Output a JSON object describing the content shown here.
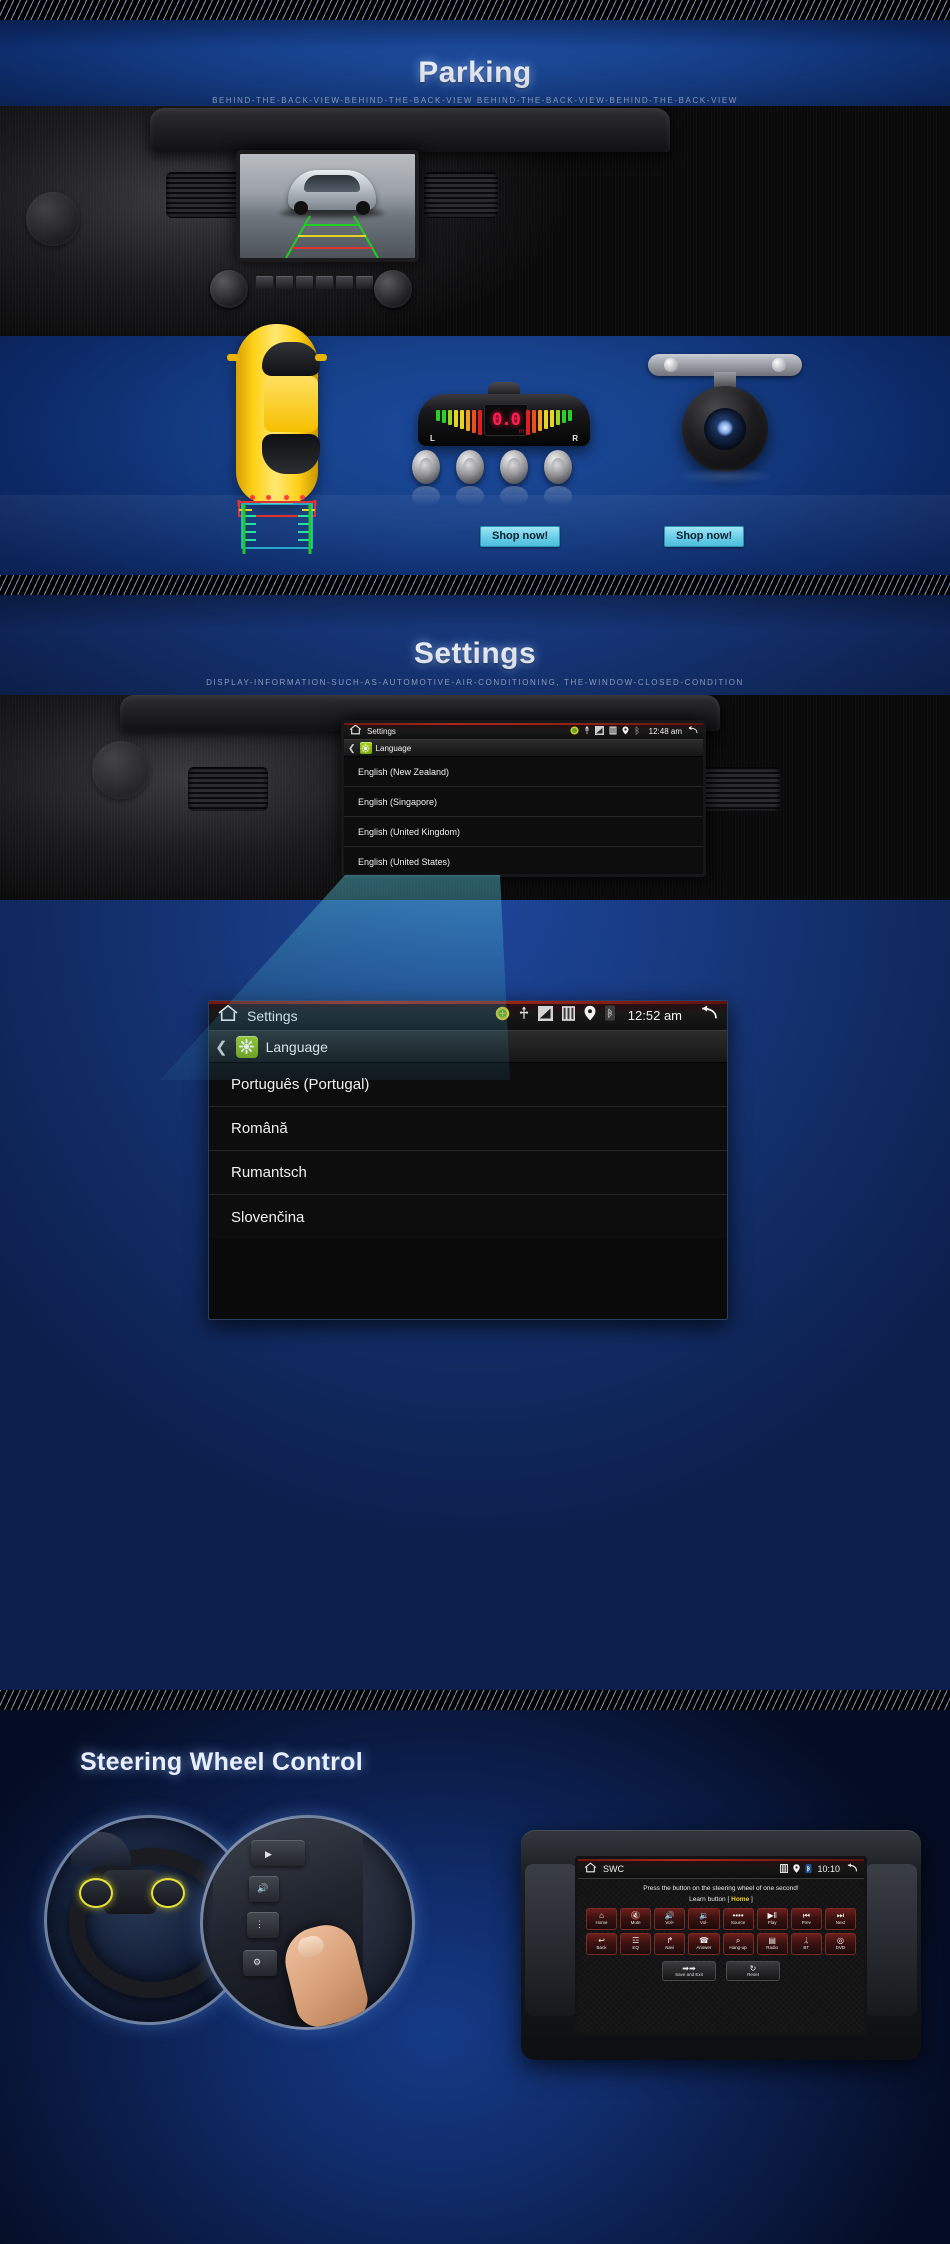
{
  "sections": {
    "parking": {
      "title": "Parking",
      "subtitle": "BEHIND-THE-BACK-VIEW-BEHIND-THE-BACK-VIEW BEHIND-THE-BACK-VIEW-BEHIND-THE-BACK-VIEW",
      "sensor_display": {
        "value": "0.0",
        "unit": "m",
        "left_label": "L",
        "right_label": "R"
      },
      "shop_button_sensor": "Shop now!",
      "shop_button_camera": "Shop now!"
    },
    "settings": {
      "title": "Settings",
      "subtitle": "DISPLAY-INFORMATION-SUCH-AS-AUTOMOTIVE-AIR-CONDITIONING, THE-WINDOW-CLOSED-CONDITION",
      "screen_small": {
        "status_title": "Settings",
        "clock": "12:48 am",
        "breadcrumb": "Language",
        "languages": [
          "English (New Zealand)",
          "English (Singapore)",
          "English (United Kingdom)",
          "English (United States)"
        ]
      },
      "screen_large": {
        "status_title": "Settings",
        "clock": "12:52 am",
        "breadcrumb": "Language",
        "languages": [
          "Português (Portugal)",
          "Română",
          "Rumantsch",
          "Slovenčina"
        ]
      },
      "status_icons": [
        "android-icon",
        "usb-icon",
        "signal-icon",
        "sd-card-icon",
        "location-pin-icon",
        "bluetooth-icon"
      ],
      "back_icon": "back-arrow-icon"
    },
    "swc": {
      "title": "Steering Wheel Control",
      "screen": {
        "status_title": "SWC",
        "clock": "10:10",
        "status_icons": [
          "sd-card-icon",
          "location-pin-icon",
          "bluetooth-icon"
        ],
        "back_icon": "back-arrow-icon",
        "hint": "Press the button on the steering wheel of one second!",
        "learn_label": "Learn button",
        "learn_open": "[",
        "learn_value": "Home",
        "learn_close": "]",
        "keys": [
          {
            "label": "Home",
            "glyph": "⌂",
            "icon": "home-icon"
          },
          {
            "label": "Mute",
            "glyph": "🔇",
            "icon": "mute-icon"
          },
          {
            "label": "Vol+",
            "glyph": "🔊",
            "icon": "volume-up-icon"
          },
          {
            "label": "Vol-",
            "glyph": "🔉",
            "icon": "volume-down-icon"
          },
          {
            "label": "Source",
            "glyph": "••••",
            "icon": "source-icon"
          },
          {
            "label": "Play",
            "glyph": "▶‖",
            "icon": "play-pause-icon"
          },
          {
            "label": "Prev",
            "glyph": "⏮",
            "icon": "previous-icon"
          },
          {
            "label": "Next",
            "glyph": "⏭",
            "icon": "next-icon"
          },
          {
            "label": "Back",
            "glyph": "↩",
            "icon": "back-icon"
          },
          {
            "label": "EQ",
            "glyph": "☲",
            "icon": "equalizer-icon"
          },
          {
            "label": "Navi",
            "glyph": "↱",
            "icon": "navigation-icon"
          },
          {
            "label": "Answer",
            "glyph": "☎",
            "icon": "answer-call-icon"
          },
          {
            "label": "Hang-up",
            "glyph": "⌕",
            "icon": "hang-up-icon"
          },
          {
            "label": "Radio",
            "glyph": "▤",
            "icon": "radio-icon"
          },
          {
            "label": "BT",
            "glyph": "ᛦ",
            "icon": "bluetooth-icon"
          },
          {
            "label": "DVD",
            "glyph": "◎",
            "icon": "dvd-icon"
          }
        ],
        "bottom_keys": [
          {
            "label": "Save and Exit",
            "glyph": "➡➡",
            "icon": "save-exit-icon"
          },
          {
            "label": "Reset",
            "glyph": "↻",
            "icon": "reset-icon"
          }
        ]
      }
    }
  },
  "colors": {
    "banner_blue": "#16408c",
    "accent_cyan": "#6fcfe9",
    "android_green": "#a8d11e",
    "learn_yellow": "#f2d02a",
    "sensor_red": "#ff1e4e"
  }
}
